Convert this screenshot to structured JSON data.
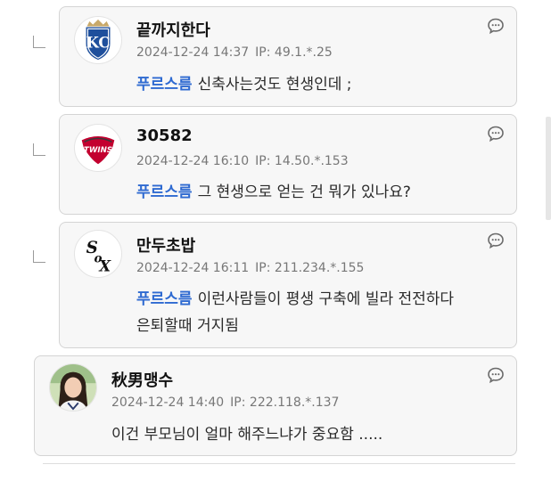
{
  "comments": [
    {
      "nickname": "끝까지한다",
      "avatar": "kansas-city-royals-logo",
      "datetime": "2024-12-24 14:37",
      "ip_label": "IP:",
      "ip": "49.1.*.25",
      "mention": "푸르스름",
      "text_lines": [
        "신축사는것도 현생인데 ;"
      ],
      "is_reply": true
    },
    {
      "nickname": "30582",
      "avatar": "lg-twins-logo",
      "avatar_text": "TWINS",
      "datetime": "2024-12-24 16:10",
      "ip_label": "IP:",
      "ip": "14.50.*.153",
      "mention": "푸르스름",
      "text_lines": [
        "그 현생으로 얻는 건 뭐가 있나요?"
      ],
      "is_reply": true
    },
    {
      "nickname": "만두초밥",
      "avatar": "chicago-white-sox-logo",
      "datetime": "2024-12-24 16:11",
      "ip_label": "IP:",
      "ip": "211.234.*.155",
      "mention": "푸르스름",
      "text_lines": [
        "이런사람들이 평생 구축에 빌라 전전하다",
        "은퇴할때 거지됨"
      ],
      "is_reply": true
    },
    {
      "nickname": "秋男맹수",
      "avatar": "user-photo",
      "datetime": "2024-12-24 14:40",
      "ip_label": "IP:",
      "ip": "222.118.*.137",
      "mention": "",
      "text_lines": [
        "이건 부모님이 얼마 해주느냐가 중요함 ....."
      ],
      "is_reply": false
    }
  ],
  "colors": {
    "mention": "#2e6ad1",
    "card_background": "#f7f7f7",
    "card_border": "#d4d4d4",
    "meta_text": "#777777",
    "kc_blue": "#1e4f9c",
    "kc_gold": "#c8a96a",
    "twins_red": "#c3002f"
  },
  "icons": {
    "reply": "speech-bubble-icon",
    "reply_marker": "reply-arrow-icon"
  }
}
